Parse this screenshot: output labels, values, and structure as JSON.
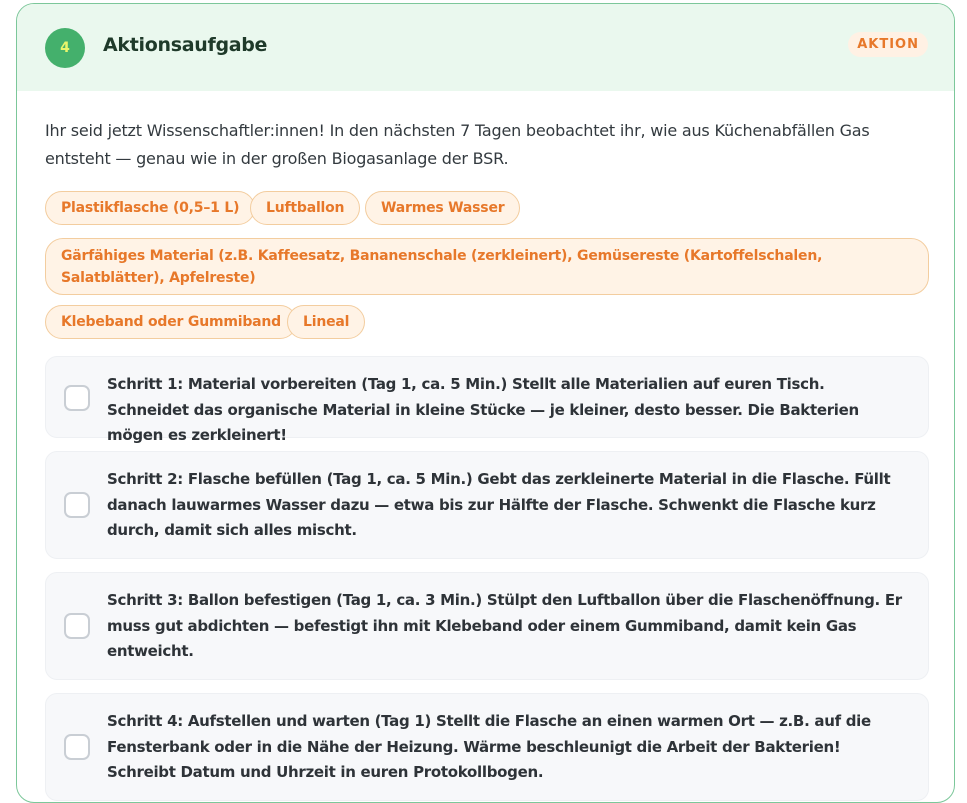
{
  "task": {
    "number": "4",
    "title": "Aktionsaufgabe",
    "type_badge": "AKTION",
    "intro": "Ihr seid jetzt Wissenschaftler:innen! In den nächsten 7 Tagen beobachtet ihr, wie aus Küchenabfällen Gas entsteht — genau wie in der großen Biogasanlage der BSR."
  },
  "materials": [
    "Plastikflasche (0,5–1 L)",
    "Luftballon",
    "Warmes Wasser",
    "Gärfähiges Material (z.B. Kaffeesatz, Bananenschale (zerkleinert), Gemüsereste (Kartoffelschalen, Salatblätter), Apfelreste)",
    "Klebeband oder Gummiband",
    "Lineal"
  ],
  "steps": [
    {
      "text": "Schritt 1: Material vorbereiten (Tag 1, ca. 5 Min.) Stellt alle Materialien auf euren Tisch. Schneidet das organische Material in kleine Stücke — je kleiner, desto besser. Die Bakterien mögen es zerkleinert!",
      "checked": false
    },
    {
      "text": "Schritt 2: Flasche befüllen (Tag 1, ca. 5 Min.) Gebt das zerkleinerte Material in die Flasche. Füllt danach lauwarmes Wasser dazu — etwa bis zur Hälfte der Flasche. Schwenkt die Flasche kurz durch, damit sich alles mischt.",
      "checked": false
    },
    {
      "text": "Schritt 3: Ballon befestigen (Tag 1, ca. 3 Min.) Stülpt den Luftballon über die Flaschenöffnung. Er muss gut abdichten — befestigt ihn mit Klebeband oder einem Gummiband, damit kein Gas entweicht.",
      "checked": false
    },
    {
      "text": "Schritt 4: Aufstellen und warten (Tag 1) Stellt die Flasche an einen warmen Ort — z.B. auf die Fensterbank oder in die Nähe der Heizung. Wärme beschleunigt die Arbeit der Bakterien! Schreibt Datum und Uhrzeit in euren Protokollbogen.",
      "checked": false
    }
  ],
  "colors": {
    "header_bg": "#eaf8ee",
    "border": "#7cc79a",
    "step_circle": "#44b06c",
    "accent_orange": "#e7782a"
  }
}
